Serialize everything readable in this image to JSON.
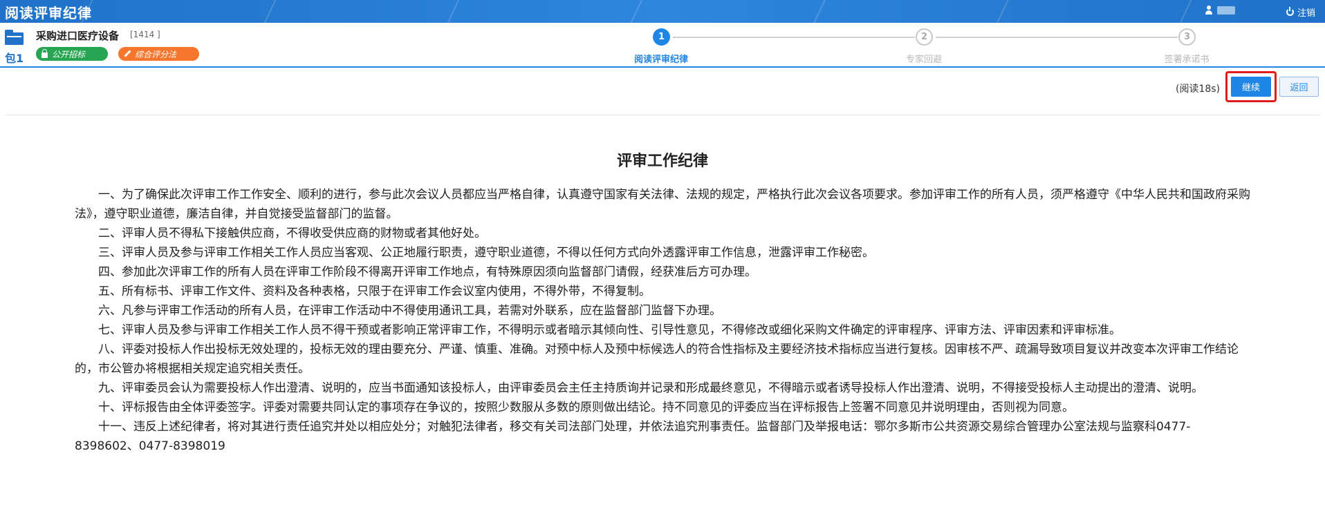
{
  "header": {
    "app_title": "阅读评审纪律",
    "logout_label": "注销"
  },
  "project": {
    "package_label": "包1",
    "name": "采购进口医疗设备",
    "code": "[1414 ]",
    "tags": [
      {
        "label": "公开招标",
        "color": "#27a552"
      },
      {
        "label": "综合评分法",
        "color": "#f5762c"
      }
    ]
  },
  "steps": [
    {
      "number": "1",
      "label": "阅读评审纪律",
      "status": "active"
    },
    {
      "number": "2",
      "label": "专家回避",
      "status": "inactive"
    },
    {
      "number": "3",
      "label": "签署承诺书",
      "status": "inactive"
    }
  ],
  "actions": {
    "read_timer": "(阅读18s)",
    "continue_label": "继续",
    "back_label": "返回"
  },
  "document": {
    "title": "评审工作纪律",
    "paragraphs": [
      "一、为了确保此次评审工作工作安全、顺利的进行，参与此次会议人员都应当严格自律，认真遵守国家有关法律、法规的规定，严格执行此次会议各项要求。参加评审工作的所有人员，须严格遵守《中华人民共和国政府采购法》，遵守职业道德，廉洁自律，并自觉接受监督部门的监督。",
      "二、评审人员不得私下接触供应商，不得收受供应商的财物或者其他好处。",
      "三、评审人员及参与评审工作相关工作人员应当客观、公正地履行职责，遵守职业道德，不得以任何方式向外透露评审工作信息，泄露评审工作秘密。",
      "四、参加此次评审工作的所有人员在评审工作阶段不得离开评审工作地点，有特殊原因须向监督部门请假，经获准后方可办理。",
      "五、所有标书、评审工作文件、资料及各种表格，只限于在评审工作会议室内使用，不得外带，不得复制。",
      "六、凡参与评审工作活动的所有人员，在评审工作活动中不得使用通讯工具，若需对外联系，应在监督部门监督下办理。",
      "七、评审人员及参与评审工作相关工作人员不得干预或者影响正常评审工作，不得明示或者暗示其倾向性、引导性意见，不得修改或细化采购文件确定的评审程序、评审方法、评审因素和评审标准。",
      "八、评委对投标人作出投标无效处理的，投标无效的理由要充分、严谨、慎重、准确。对预中标人及预中标候选人的符合性指标及主要经济技术指标应当进行复核。因审核不严、疏漏导致项目复议并改变本次评审工作结论的，市公管办将根据相关规定追究相关责任。",
      "九、评审委员会认为需要投标人作出澄清、说明的，应当书面通知该投标人，由评审委员会主任主持质询并记录和形成最终意见，不得暗示或者诱导投标人作出澄清、说明，不得接受投标人主动提出的澄清、说明。",
      "十、评标报告由全体评委签字。评委对需要共同认定的事项存在争议的，按照少数服从多数的原则做出结论。持不同意见的评委应当在评标报告上签署不同意见并说明理由，否则视为同意。",
      "十一、违反上述纪律者，将对其进行责任追究并处以相应处分；对触犯法律者，移交有关司法部门处理，并依法追究刑事责任。监督部门及举报电话：鄂尔多斯市公共资源交易综合管理办公室法规与监察科0477-8398602、0477-8398019"
    ]
  }
}
